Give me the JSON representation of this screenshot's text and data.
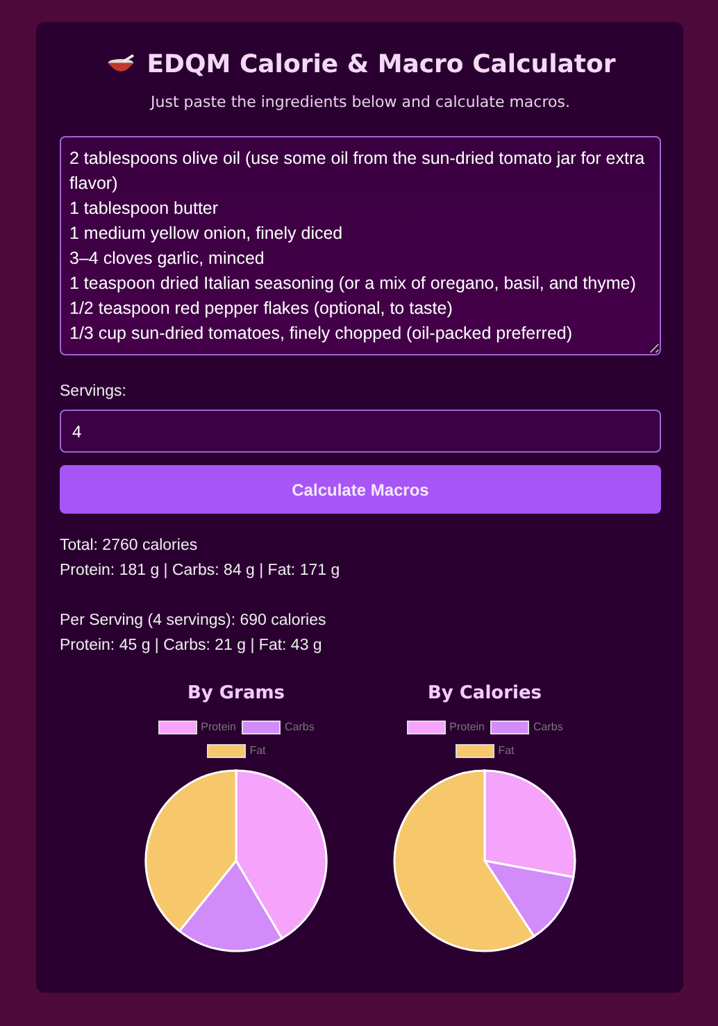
{
  "header": {
    "title": "EDQM Calorie & Macro Calculator",
    "subtitle": "Just paste the ingredients below and calculate macros."
  },
  "ingredients": {
    "value": "2 tablespoons olive oil (use some oil from the sun-dried tomato jar for extra flavor)\n1 tablespoon butter\n1 medium yellow onion, finely diced\n3–4 cloves garlic, minced\n1 teaspoon dried Italian seasoning (or a mix of oregano, basil, and thyme)\n1/2 teaspoon red pepper flakes (optional, to taste)\n1/3 cup sun-dried tomatoes, finely chopped (oil-packed preferred)"
  },
  "servings": {
    "label": "Servings:",
    "value": "4"
  },
  "button": "Calculate Macros",
  "results": [
    "Total: 2760 calories",
    "Protein: 181 g | Carbs: 84 g | Fat: 171 g",
    "Per Serving (4 servings): 690 calories",
    "Protein: 45 g | Carbs: 21 g | Fat: 43 g"
  ],
  "charts": [
    {
      "chart_data": {
        "type": "pie",
        "title": "By Grams",
        "categories": [
          "Protein",
          "Carbs",
          "Fat"
        ],
        "series": [
          {
            "values": [
              41.5,
              19.3,
              39.2
            ]
          }
        ],
        "legend": "top",
        "colors": [
          "#f5a3fb",
          "#d18cf9",
          "#f7c76b"
        ]
      }
    },
    {
      "chart_data": {
        "type": "pie",
        "title": "By Calories",
        "categories": [
          "Protein",
          "Carbs",
          "Fat"
        ],
        "series": [
          {
            "values": [
              27.9,
              12.9,
              59.2
            ]
          }
        ],
        "legend": "top",
        "colors": [
          "#f5a3fb",
          "#d18cf9",
          "#f7c76b"
        ]
      }
    }
  ]
}
